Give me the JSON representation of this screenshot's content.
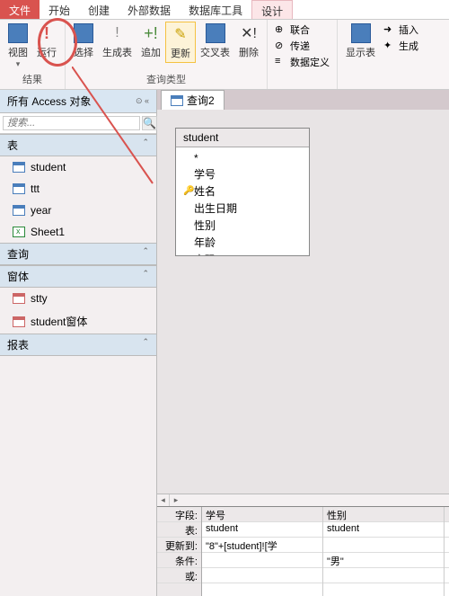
{
  "tabs": {
    "file": "文件",
    "items": [
      "开始",
      "创建",
      "外部数据",
      "数据库工具"
    ],
    "active": "设计"
  },
  "ribbon": {
    "group_result": {
      "view": "视图",
      "run": "运行",
      "label": "结果"
    },
    "group_qtype": {
      "select": "选择",
      "maketable": "生成表",
      "append": "追加",
      "update": "更新",
      "crosstab": "交叉表",
      "delete": "删除",
      "label": "查询类型"
    },
    "group_extra": {
      "union": "联合",
      "passthrough": "传递",
      "datadef": "数据定义"
    },
    "group_show": {
      "showtable": "显示表",
      "insert": "插入",
      "generate": "生成"
    }
  },
  "sidebar": {
    "title": "所有 Access 对象",
    "search_placeholder": "搜索...",
    "groups": {
      "tables": {
        "label": "表",
        "items": [
          "student",
          "ttt",
          "year",
          "Sheet1"
        ]
      },
      "queries": {
        "label": "查询"
      },
      "forms": {
        "label": "窗体",
        "items": [
          "stty",
          "student窗体"
        ]
      },
      "reports": {
        "label": "报表"
      }
    }
  },
  "content": {
    "tab": "查询2",
    "table_box": {
      "title": "student",
      "fields": [
        "*",
        "学号",
        "姓名",
        "出生日期",
        "性别",
        "年龄",
        "密码"
      ],
      "key_field": "姓名"
    },
    "grid": {
      "labels": [
        "字段:",
        "表:",
        "更新到:",
        "条件:",
        "或:"
      ],
      "cols": [
        {
          "field": "学号",
          "table": "student",
          "updateto": "\"8\"+[student]![学",
          "criteria": "",
          "or": ""
        },
        {
          "field": "性别",
          "table": "student",
          "updateto": "",
          "criteria": "\"男\"",
          "or": ""
        }
      ]
    }
  }
}
